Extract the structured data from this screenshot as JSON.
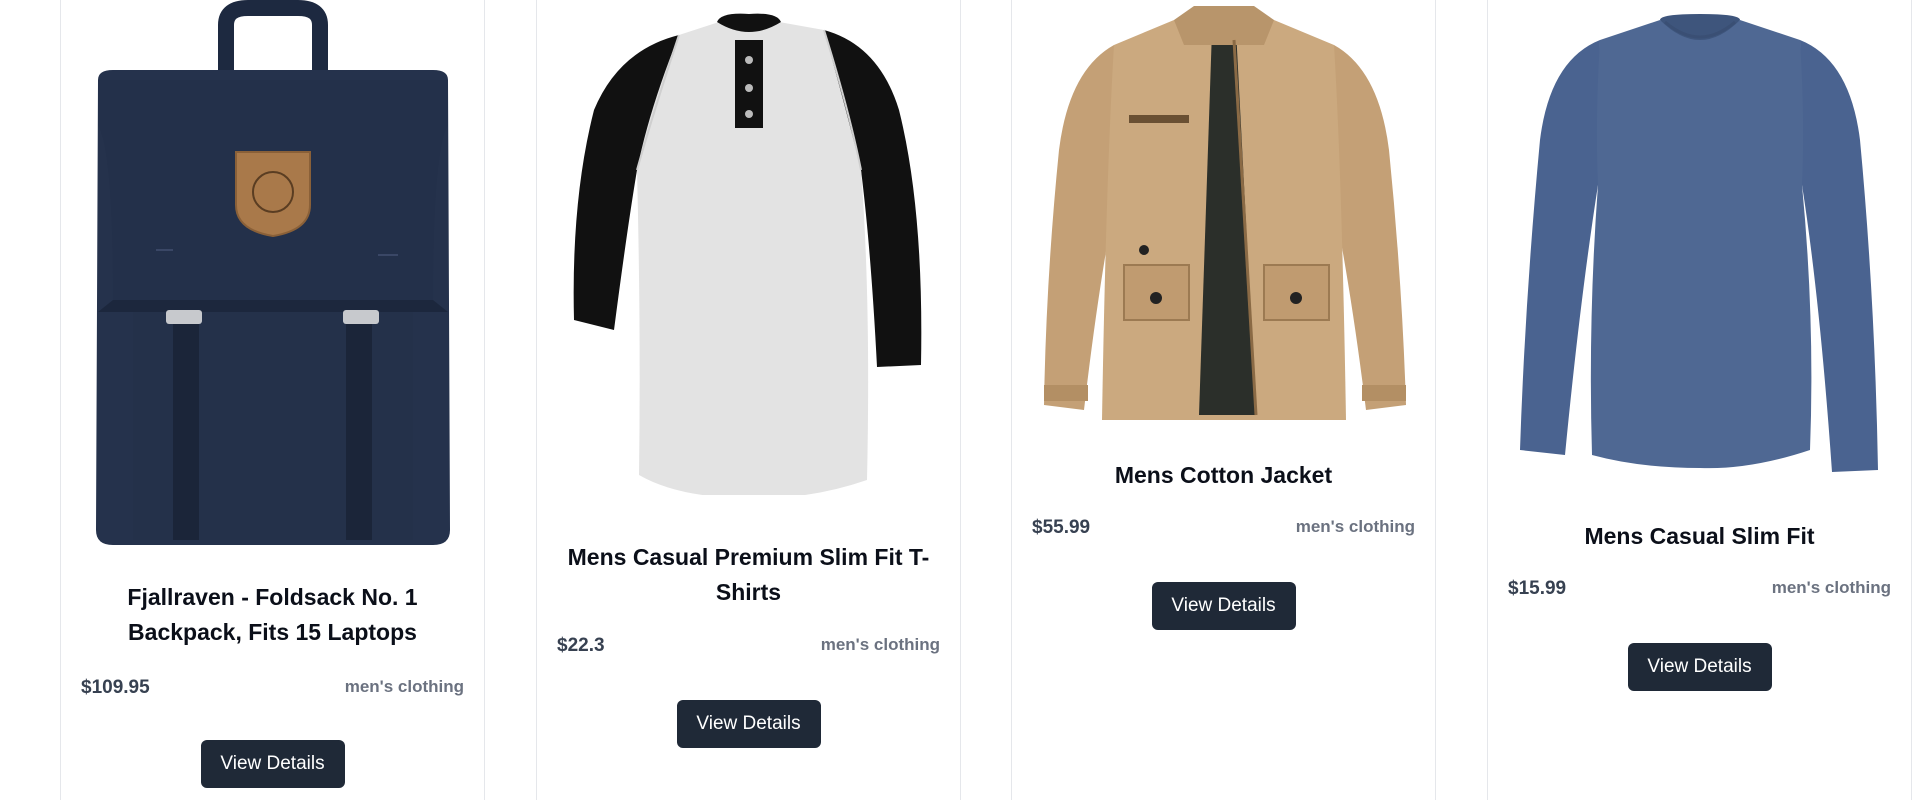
{
  "products": [
    {
      "title": "Fjallraven - Foldsack No. 1 Backpack, Fits 15 Laptops",
      "price": "$109.95",
      "category": "men's clothing",
      "button_label": "View Details",
      "image": "backpack-image",
      "colors": {
        "main": "#22304a",
        "patch": "#a9794a"
      }
    },
    {
      "title": "Mens Casual Premium Slim Fit T-Shirts",
      "price": "$22.3",
      "category": "men's clothing",
      "button_label": "View Details",
      "image": "raglan-tshirt-image",
      "colors": {
        "body": "#e3e3e3",
        "sleeves": "#111111"
      }
    },
    {
      "title": "Mens Cotton Jacket",
      "price": "$55.99",
      "category": "men's clothing",
      "button_label": "View Details",
      "image": "cotton-jacket-image",
      "colors": {
        "main": "#c8a57b",
        "lining": "#2b2f2a"
      }
    },
    {
      "title": "Mens Casual Slim Fit",
      "price": "$15.99",
      "category": "men's clothing",
      "button_label": "View Details",
      "image": "longsleeve-shirt-image",
      "colors": {
        "main": "#4c6591"
      }
    }
  ],
  "theme": {
    "button_bg": "#1f2937",
    "button_text": "#ffffff",
    "title_color": "#0b0f19",
    "price_color": "#374151",
    "category_color": "#6b7280"
  }
}
